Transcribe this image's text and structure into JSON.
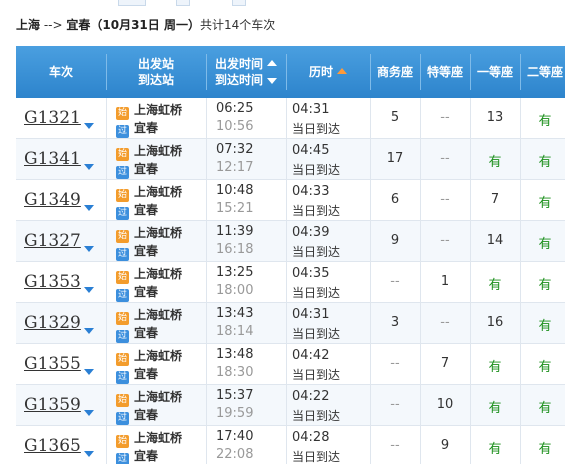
{
  "route": {
    "from": "上海",
    "arrow": " --> ",
    "to": "宜春",
    "date_text": "（10月31日  周一）",
    "count_text": "共计14个车次"
  },
  "header": {
    "train": "车次",
    "station_top": "出发站",
    "station_bottom": "到达站",
    "time_top": "出发时间",
    "time_bottom": "到达时间",
    "duration": "历时",
    "business": "商务座",
    "special": "特等座",
    "first": "一等座",
    "second": "二等座"
  },
  "badges": {
    "start": "始",
    "pass": "过"
  },
  "rows": [
    {
      "train": "G1321",
      "from": "上海虹桥",
      "to": "宜春",
      "dep": "06:25",
      "arr": "10:56",
      "dur": "04:31",
      "arrive_day": "当日到达",
      "business": "5",
      "special": "--",
      "first": "13",
      "second": "有"
    },
    {
      "train": "G1341",
      "from": "上海虹桥",
      "to": "宜春",
      "dep": "07:32",
      "arr": "12:17",
      "dur": "04:45",
      "arrive_day": "当日到达",
      "business": "17",
      "special": "--",
      "first": "有",
      "second": "有"
    },
    {
      "train": "G1349",
      "from": "上海虹桥",
      "to": "宜春",
      "dep": "10:48",
      "arr": "15:21",
      "dur": "04:33",
      "arrive_day": "当日到达",
      "business": "6",
      "special": "--",
      "first": "7",
      "second": "有"
    },
    {
      "train": "G1327",
      "from": "上海虹桥",
      "to": "宜春",
      "dep": "11:39",
      "arr": "16:18",
      "dur": "04:39",
      "arrive_day": "当日到达",
      "business": "9",
      "special": "--",
      "first": "14",
      "second": "有"
    },
    {
      "train": "G1353",
      "from": "上海虹桥",
      "to": "宜春",
      "dep": "13:25",
      "arr": "18:00",
      "dur": "04:35",
      "arrive_day": "当日到达",
      "business": "--",
      "special": "1",
      "first": "有",
      "second": "有"
    },
    {
      "train": "G1329",
      "from": "上海虹桥",
      "to": "宜春",
      "dep": "13:43",
      "arr": "18:14",
      "dur": "04:31",
      "arrive_day": "当日到达",
      "business": "3",
      "special": "--",
      "first": "16",
      "second": "有"
    },
    {
      "train": "G1355",
      "from": "上海虹桥",
      "to": "宜春",
      "dep": "13:48",
      "arr": "18:30",
      "dur": "04:42",
      "arrive_day": "当日到达",
      "business": "--",
      "special": "7",
      "first": "有",
      "second": "有"
    },
    {
      "train": "G1359",
      "from": "上海虹桥",
      "to": "宜春",
      "dep": "15:37",
      "arr": "19:59",
      "dur": "04:22",
      "arrive_day": "当日到达",
      "business": "--",
      "special": "10",
      "first": "有",
      "second": "有"
    },
    {
      "train": "G1365",
      "from": "上海虹桥",
      "to": "宜春",
      "dep": "17:40",
      "arr": "22:08",
      "dur": "04:28",
      "arrive_day": "当日到达",
      "business": "--",
      "special": "9",
      "first": "有",
      "second": "有"
    }
  ]
}
